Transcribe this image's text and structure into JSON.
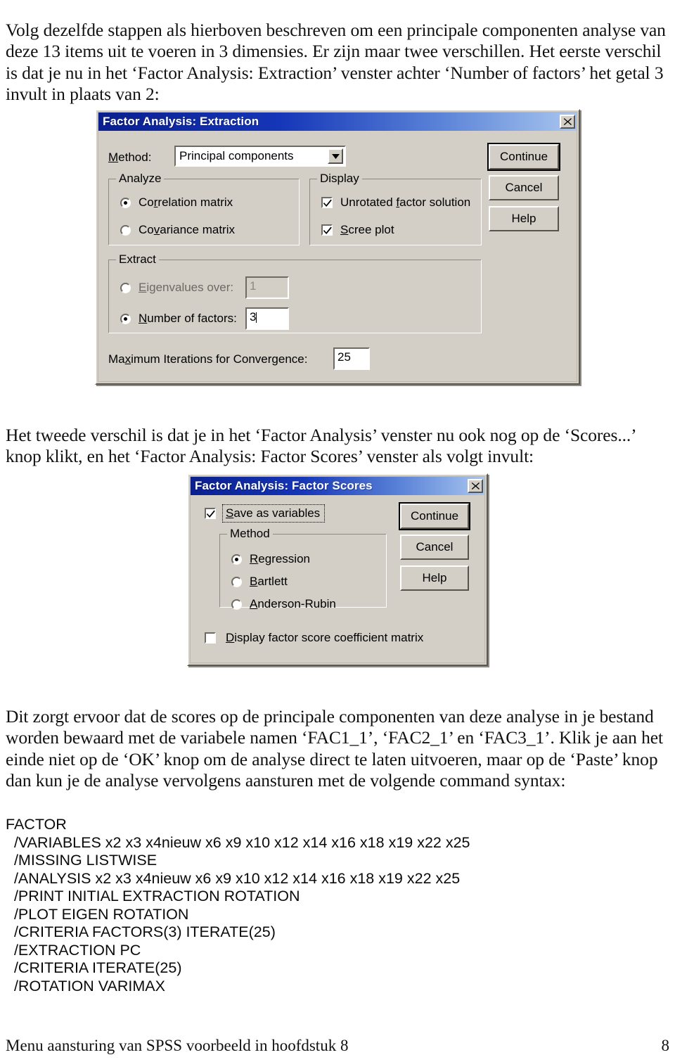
{
  "document": {
    "paragraphs": {
      "intro": "Volg dezelfde stappen als hierboven beschreven om een principale componenten analyse van deze 13 items uit te voeren in 3 dimensies. Er zijn maar twee verschillen. Het eerste verschil is dat je nu in het ‘Factor Analysis: Extraction’ venster achter ‘Number of factors’ het getal 3 invult in plaats van 2:",
      "middle": "Het tweede verschil is dat je in het ‘Factor Analysis’ venster nu ook nog op de ‘Scores...’ knop klikt, en het ‘Factor Analysis: Factor Scores’ venster als volgt invult:",
      "after": "Dit zorgt ervoor dat de scores op de principale componenten van deze analyse in je bestand worden bewaard met de variabele namen ‘FAC1_1’, ‘FAC2_1’ en ‘FAC3_1’. Klik je aan het einde niet op de ‘OK’ knop om de analyse direct te laten uitvoeren, maar op de ‘Paste’ knop dan kun je de analyse vervolgens aansturen met de volgende command syntax:"
    },
    "syntax": {
      "lines": [
        "FACTOR",
        "  /VARIABLES x2 x3 x4nieuw x6 x9 x10 x12 x14 x16 x18 x19 x22 x25",
        "  /MISSING LISTWISE",
        "  /ANALYSIS x2 x3 x4nieuw x6 x9 x10 x12 x14 x16 x18 x19 x22 x25",
        "  /PRINT INITIAL EXTRACTION ROTATION",
        "  /PLOT EIGEN ROTATION",
        "  /CRITERIA FACTORS(3) ITERATE(25)",
        "  /EXTRACTION PC",
        "  /CRITERIA ITERATE(25)",
        "  /ROTATION VARIMAX"
      ]
    },
    "footer": {
      "left": "Menu aansturing van SPSS voorbeeld in hoofdstuk 8",
      "page_number": "8"
    }
  },
  "extraction_dialog": {
    "title": "Factor Analysis: Extraction",
    "close_icon": "close-icon",
    "method_label": "Method:",
    "method_value": "Principal components",
    "method_dropdown_icon": "chevron-down-icon",
    "analyze_group": {
      "legend": "Analyze",
      "options": [
        {
          "label": "Correlation matrix",
          "selected": true
        },
        {
          "label": "Covariance matrix",
          "selected": false
        }
      ]
    },
    "display_group": {
      "legend": "Display",
      "options": [
        {
          "label": "Unrotated factor solution",
          "checked": true
        },
        {
          "label": "Scree plot",
          "checked": true
        }
      ]
    },
    "extract_group": {
      "legend": "Extract",
      "eigenvalues_label": "Eigenvalues over:",
      "eigenvalues_value": "1",
      "eigenvalues_selected": false,
      "factors_label": "Number of factors:",
      "factors_value": "3",
      "factors_selected": true
    },
    "max_iterations_label": "Maximum Iterations for Convergence:",
    "max_iterations_value": "25",
    "buttons": [
      {
        "label": "Continue",
        "default": true
      },
      {
        "label": "Cancel",
        "default": false
      },
      {
        "label": "Help",
        "default": false
      }
    ]
  },
  "factor_scores_dialog": {
    "title": "Factor Analysis: Factor Scores",
    "close_icon": "close-icon",
    "save_as_variables": {
      "label": "Save as variables",
      "checked": true
    },
    "method_group": {
      "legend": "Method",
      "options": [
        {
          "label": "Regression",
          "selected": true
        },
        {
          "label": "Bartlett",
          "selected": false
        },
        {
          "label": "Anderson-Rubin",
          "selected": false
        }
      ]
    },
    "display_coefficient": {
      "label": "Display factor score coefficient matrix",
      "checked": false
    },
    "buttons": [
      {
        "label": "Continue",
        "default": true
      },
      {
        "label": "Cancel",
        "default": false
      },
      {
        "label": "Help",
        "default": false
      }
    ]
  },
  "colors": {
    "dialog_face": "#d3cfc7",
    "titlebar_start": "#0a1f8f",
    "titlebar_end": "#a9c6ef",
    "text": "#000000"
  }
}
